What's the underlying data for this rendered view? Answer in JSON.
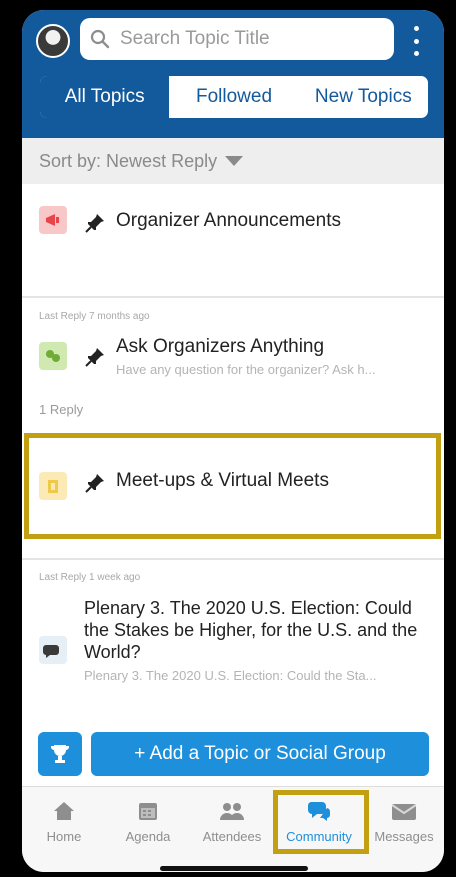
{
  "search": {
    "placeholder": "Search Topic Title"
  },
  "tabs": [
    "All Topics",
    "Followed",
    "New Topics"
  ],
  "sort": {
    "label": "Sort by:",
    "value": "Newest Reply"
  },
  "topics": [
    {
      "title": "Organizer Announcements",
      "icon_color": "#f36f72"
    },
    {
      "meta": "Last Reply 7 months ago",
      "title": "Ask Organizers Anything",
      "subtitle": "Have any question for the organizer? Ask h...",
      "replies": "1 Reply",
      "icon_color": "#8bc34a"
    },
    {
      "title": "Meet-ups & Virtual Meets",
      "icon_color": "#f5d36a"
    },
    {
      "meta": "Last Reply 1 week ago",
      "title": "Plenary 3. The 2020 U.S. Election: Could the Stakes be Higher, for the U.S. and the World?",
      "subtitle": "Plenary 3. The 2020 U.S. Election: Could the Sta..."
    }
  ],
  "add_button": "+ Add a Topic or Social Group",
  "bottom_tabs": [
    "Home",
    "Agenda",
    "Attendees",
    "Community",
    "Messages"
  ],
  "colors": {
    "header": "#135a9c",
    "accent": "#1e8fdb",
    "highlight": "#c2a012"
  }
}
